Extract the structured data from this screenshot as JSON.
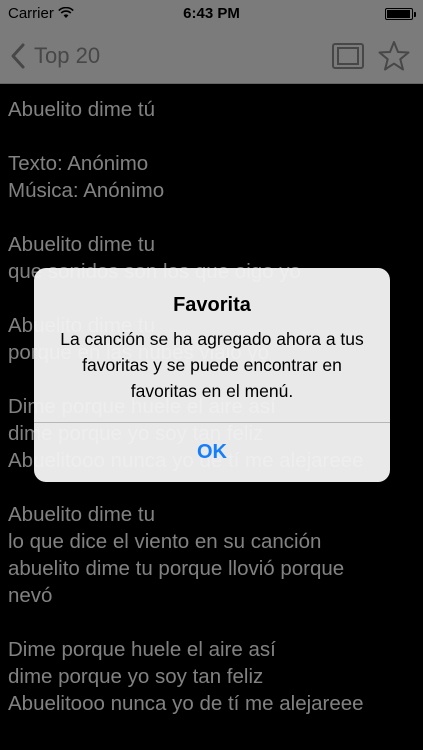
{
  "status_bar": {
    "carrier": "Carrier",
    "time": "6:43 PM",
    "battery_level": 0.95
  },
  "nav": {
    "back_label": "Top 20",
    "icons": [
      "chevron-left-icon",
      "tv-icon",
      "star-icon"
    ]
  },
  "lyrics": {
    "stanzas": [
      [
        "Abuelito dime tú"
      ],
      [
        "Texto: Anónimo",
        "Música: Anónimo"
      ],
      [
        "Abuelito dime tu",
        "que sonidos son los que oigo yo"
      ],
      [
        "Abuelito dime tu",
        "porque en las nubes viajo yo"
      ],
      [
        "Dime porque huele el aire así",
        "dime porque yo soy tan feliz",
        "Abuelitooo nunca yo de tí me alejareee"
      ],
      [
        "Abuelito dime tu",
        "lo que dice el viento en su canción",
        "abuelito dime tu porque llovió porque",
        "nevó"
      ],
      [
        "Dime porque huele el aire así",
        "dime porque yo soy tan feliz",
        "Abuelitooo nunca yo de tí me alejareee"
      ]
    ]
  },
  "alert": {
    "title": "Favorita",
    "message": "La canción se ha agregado ahora a tus favoritas y se puede encontrar en favoritas en el menú.",
    "button": "OK"
  },
  "colors": {
    "bar_bg": "#bdbdbd",
    "nav_tint": "#6e6e6e",
    "lyrics_text": "#c7c7c7",
    "alert_button": "#157efb"
  }
}
